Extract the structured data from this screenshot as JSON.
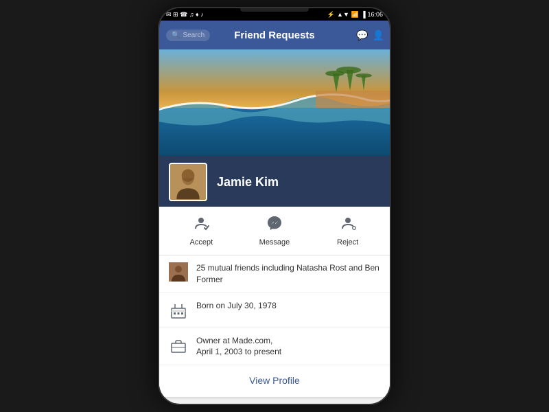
{
  "statusBar": {
    "leftIcons": [
      "☰",
      "↕",
      "📞",
      "♪",
      "♦"
    ],
    "time": "16:06",
    "rightIcons": [
      "⚡",
      "▲",
      "▼",
      "📶",
      "🔋"
    ]
  },
  "navbar": {
    "searchPlaceholder": "Search",
    "title": "Friend Requests"
  },
  "profile": {
    "name": "Jamie Kim",
    "mutualFriends": "25 mutual friends including Natasha Rost and Ben Former",
    "birthday": "Born on July 30, 1978",
    "work": "Owner at Made.com,\nApril 1, 2003 to present"
  },
  "actions": {
    "accept": "Accept",
    "message": "Message",
    "reject": "Reject"
  },
  "viewProfile": "View Profile"
}
